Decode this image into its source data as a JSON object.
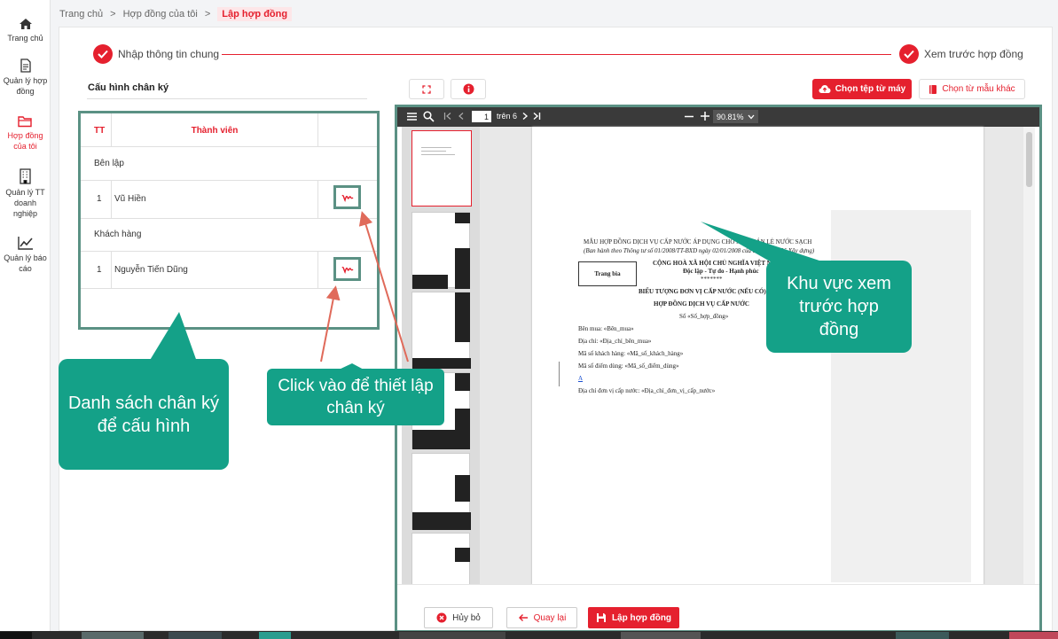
{
  "sidebar": {
    "items": [
      {
        "label": "Trang chủ",
        "icon": "home-icon"
      },
      {
        "label": "Quản lý hợp đồng",
        "icon": "document-icon"
      },
      {
        "label": "Hợp đồng của tôi",
        "icon": "folder-icon",
        "active": true
      },
      {
        "label": "Quản lý TT doanh nghiệp",
        "icon": "building-icon"
      },
      {
        "label": "Quản lý báo cáo",
        "icon": "chart-icon"
      }
    ]
  },
  "breadcrumb": {
    "home": "Trang chủ",
    "sep": ">",
    "parent": "Hợp đồng của tôi",
    "current": "Lập hợp đồng"
  },
  "steps": {
    "step1": "Nhập thông tin chung",
    "step2": "Xem trước hợp đồng"
  },
  "config": {
    "title": "Cấu hình chân ký",
    "col_tt": "TT",
    "col_member": "Thành viên",
    "group_seller": "Bên lập",
    "seller_index": "1",
    "seller_name": "Vũ Hiền",
    "group_buyer": "Khách hàng",
    "buyer_index": "1",
    "buyer_name": "Nguyễn Tiến Dũng"
  },
  "toolbar": {
    "upload_label": "Chọn tệp từ máy",
    "template_label": "Chọn từ mẫu khác"
  },
  "viewer": {
    "page_current": "1",
    "page_of": "trên 6",
    "zoom": "90.81%"
  },
  "document": {
    "line1": "MẪU HỢP ĐỒNG DỊCH VỤ CẤP NƯỚC ÁP DỤNG CHO MUA BÁN LẺ NƯỚC SẠCH",
    "line2": "(Ban hành theo Thông tư số 01/2008/TT-BXD ngày 02/01/2008 của Bộ trưởng Bộ Xây dựng)",
    "cover_box": "Trang bìa",
    "republic": "CỘNG HOÀ XÃ HỘI CHỦ NGHĨA VIỆT NAM",
    "motto": "Độc lập - Tự do - Hạnh phúc",
    "stars": "*******",
    "subject": "BIỂU TƯỢNG ĐƠN VỊ CẤP NƯỚC (NẾU CÓ)",
    "contract_title": "HỢP ĐỒNG DỊCH VỤ CẤP NƯỚC",
    "number": "Số «Số_hợp_đồng»",
    "buyer": "Bên mua: «Bên_mua»",
    "address": "Địa chỉ: «Địa_chỉ_bên_mua»",
    "customer_code": "Mã số khách hàng: «Mã_số_khách_hàng»",
    "point_code": "Mã số điểm dùng: «Mã_số_điểm_dùng»",
    "link_a": "A",
    "supplier_address": "Địa chỉ đơn vị cấp nước: «Địa_chỉ_đơn_vị_cấp_nước»"
  },
  "footer": {
    "cancel": "Hủy bỏ",
    "back": "Quay lại",
    "create": "Lập hợp đồng"
  },
  "callouts": {
    "list": "Danh sách chân ký để cấu hình",
    "click": "Click vào để thiết lập chân ký",
    "preview": "Khu vực xem trước hợp đồng"
  },
  "colors": {
    "accent": "#e5202e",
    "callout": "#14a188",
    "highlight_border": "#5b9184"
  }
}
